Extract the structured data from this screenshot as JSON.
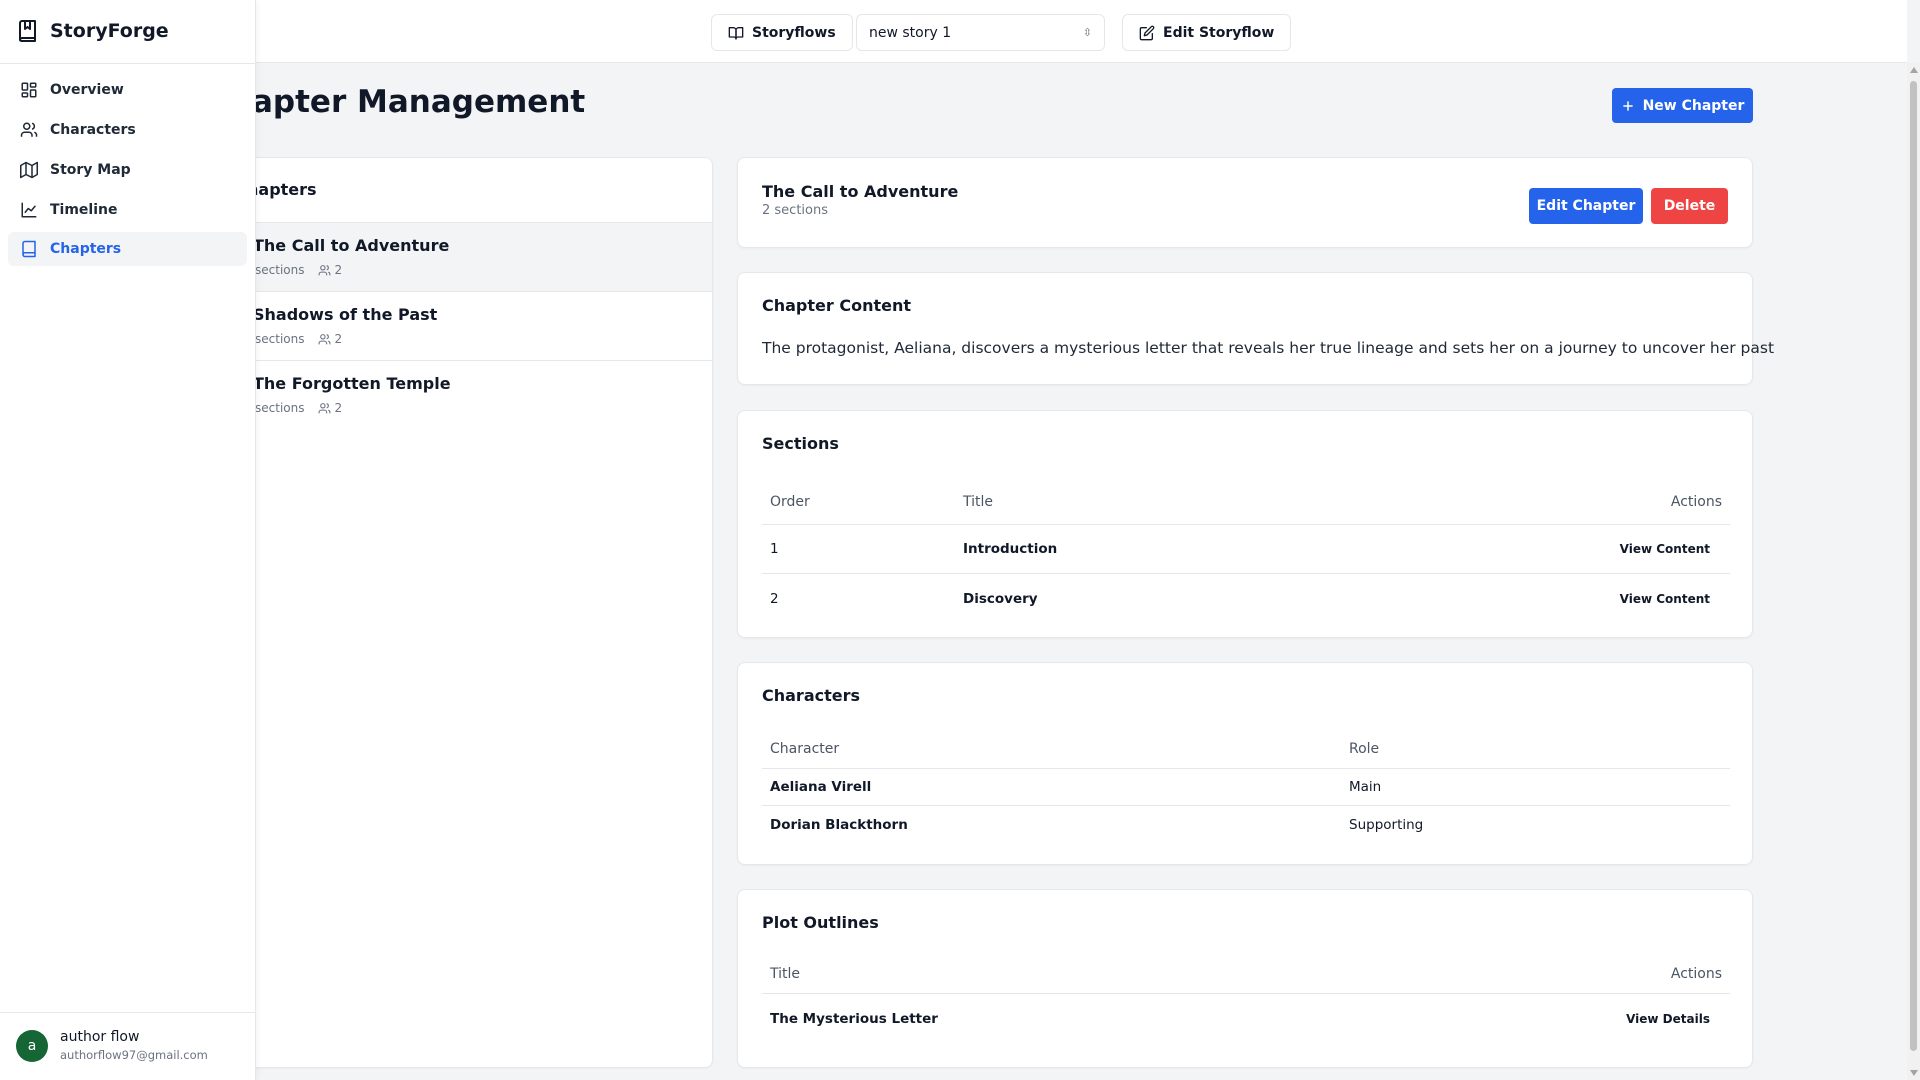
{
  "app": {
    "name": "StoryForge"
  },
  "sidebar": {
    "items": [
      {
        "label": "Overview",
        "icon": "grid-icon"
      },
      {
        "label": "Characters",
        "icon": "users-icon"
      },
      {
        "label": "Story Map",
        "icon": "map-icon"
      },
      {
        "label": "Timeline",
        "icon": "line-chart-icon"
      },
      {
        "label": "Chapters",
        "icon": "book-icon",
        "active": true
      }
    ],
    "user": {
      "initial": "a",
      "name": "author flow",
      "email": "authorflow97@gmail.com"
    }
  },
  "header": {
    "storyflows_label": "Storyflows",
    "story_select_value": "new story 1",
    "edit_storyflow_label": "Edit Storyflow"
  },
  "page": {
    "title": "apter Management",
    "new_chapter_label": "New Chapter"
  },
  "chapters_list": {
    "heading": "hapters",
    "items": [
      {
        "title": "The Call to Adventure",
        "sections": "sections",
        "characters": "2",
        "selected": true
      },
      {
        "title": "Shadows of the Past",
        "sections": "sections",
        "characters": "2"
      },
      {
        "title": "The Forgotten Temple",
        "sections": "sections",
        "characters": "2"
      }
    ]
  },
  "detail": {
    "title": "The Call to Adventure",
    "subtitle": "2 sections",
    "edit_label": "Edit Chapter",
    "delete_label": "Delete",
    "content": {
      "heading": "Chapter Content",
      "text": "The protagonist, Aeliana, discovers a mysterious letter that reveals her true lineage and sets her on a journey to uncover her past"
    },
    "sections": {
      "heading": "Sections",
      "columns": [
        "Order",
        "Title",
        "Actions"
      ],
      "rows": [
        {
          "order": "1",
          "title": "Introduction",
          "action": "View Content"
        },
        {
          "order": "2",
          "title": "Discovery",
          "action": "View Content"
        }
      ]
    },
    "characters": {
      "heading": "Characters",
      "columns": [
        "Character",
        "Role"
      ],
      "rows": [
        {
          "name": "Aeliana Virell",
          "role": "Main"
        },
        {
          "name": "Dorian Blackthorn",
          "role": "Supporting"
        }
      ]
    },
    "plots": {
      "heading": "Plot Outlines",
      "columns": [
        "Title",
        "Actions"
      ],
      "rows": [
        {
          "title": "The Mysterious Letter",
          "action": "View Details"
        }
      ]
    }
  },
  "colors": {
    "primary": "#2563eb",
    "danger": "#ef4444",
    "avatar": "#166534",
    "background": "#f3f4f6"
  }
}
